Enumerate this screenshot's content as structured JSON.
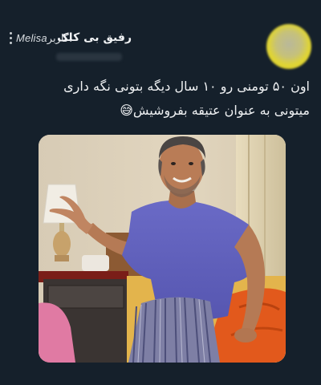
{
  "tweet": {
    "display_name": "رفیق بی کلک",
    "caption_prefix": "کاربر:",
    "caption_brand": "Melisa",
    "text_line1": "اون ۵۰ تومنی رو ۱۰ سال دیگه بتونی نگه داری",
    "text_line2": "میتونی به عنوان عتیقه بفروشیش",
    "emoji": "😅",
    "media_icon": "photo-man-in-pajamas-gesturing"
  },
  "colors": {
    "background": "#15202b",
    "text": "#eef0f2",
    "shirt": "#5f5fbd",
    "avatar": "#e0d534"
  }
}
